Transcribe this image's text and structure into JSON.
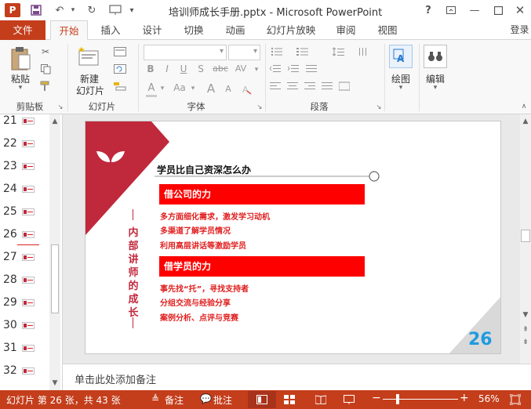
{
  "titlebar": {
    "app_logo": "P",
    "title": "培训师成长手册.pptx - Microsoft PowerPoint",
    "icons": [
      "powerpoint-icon",
      "save-icon",
      "undo-icon",
      "redo-icon",
      "presenter-icon",
      "customize-icon",
      "help-icon",
      "restore-ribbon-icon",
      "minimize-icon",
      "maximize-icon",
      "close-icon"
    ],
    "help": "?",
    "login": "登录"
  },
  "tabs": [
    {
      "label": "文件"
    },
    {
      "label": "开始"
    },
    {
      "label": "插入"
    },
    {
      "label": "设计"
    },
    {
      "label": "切换"
    },
    {
      "label": "动画"
    },
    {
      "label": "幻灯片放映"
    },
    {
      "label": "审阅"
    },
    {
      "label": "视图"
    }
  ],
  "ribbon": {
    "paste": "粘贴",
    "new_slide_line1": "新建",
    "new_slide_line2": "幻灯片",
    "drawing": "绘图",
    "editing": "编辑",
    "font_bold": "B",
    "font_italic": "I",
    "font_underline": "U",
    "font_shadow": "S",
    "font_strike": "abc",
    "font_spacing": "AV",
    "font_case": "Aa",
    "font_color": "A",
    "font_grow": "A",
    "font_shrink": "A",
    "groups": [
      "剪贴板",
      "幻灯片",
      "字体",
      "段落"
    ]
  },
  "thumbnails": [
    "21",
    "22",
    "23",
    "24",
    "25",
    "26",
    "27",
    "28",
    "29",
    "30",
    "31",
    "32"
  ],
  "slide": {
    "heading": "学员比自己资深怎么办",
    "vertical_title": "内部讲师的成长",
    "sections": [
      {
        "title": "借公司的力",
        "bullets": [
          "多方面细化需求，激发学习动机",
          "多渠道了解学员情况",
          "利用高层讲话等激励学员"
        ]
      },
      {
        "title": "借学员的力",
        "bullets": [
          "事先找“托”，寻找支持者",
          "分组交流与经验分享",
          "案例分析、点评与竞赛"
        ]
      }
    ],
    "page_number": "26",
    "colors": {
      "accent_red": "#c0283c",
      "bar_red": "#ff0000",
      "page_num_blue": "#1e9be0"
    }
  },
  "notes_placeholder": "单击此处添加备注",
  "status": {
    "slide_info": "幻灯片 第 26 张，共 43 张",
    "notes": "备注",
    "comments": "批注",
    "zoom": "56%",
    "zoom_minus": "−",
    "zoom_plus": "+"
  }
}
